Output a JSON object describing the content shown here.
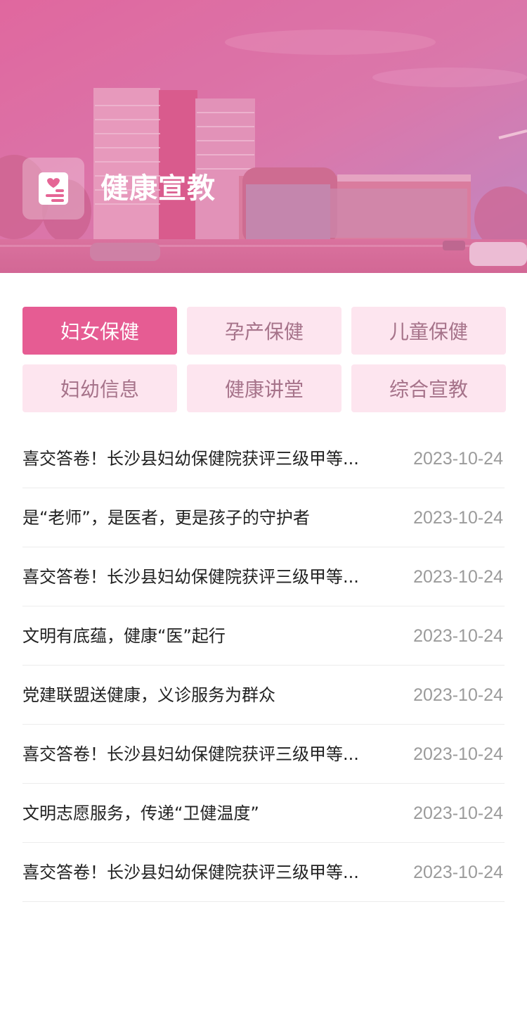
{
  "banner": {
    "title": "健康宣教",
    "icon": "health-record-icon",
    "overlay_color": "#e0619a"
  },
  "tabs": [
    {
      "label": "妇女保健",
      "active": true
    },
    {
      "label": "孕产保健",
      "active": false
    },
    {
      "label": "儿童保健",
      "active": false
    },
    {
      "label": "妇幼信息",
      "active": false
    },
    {
      "label": "健康讲堂",
      "active": false
    },
    {
      "label": "综合宣教",
      "active": false
    }
  ],
  "news": [
    {
      "title": "喜交答卷！长沙县妇幼保健院获评三级甲等...",
      "date": "2023-10-24"
    },
    {
      "title": "是“老师”，是医者，更是孩子的守护者",
      "date": "2023-10-24"
    },
    {
      "title": "喜交答卷！长沙县妇幼保健院获评三级甲等...",
      "date": "2023-10-24"
    },
    {
      "title": "文明有底蕴，健康“医”起行",
      "date": "2023-10-24"
    },
    {
      "title": "党建联盟送健康，义诊服务为群众",
      "date": "2023-10-24"
    },
    {
      "title": "喜交答卷！长沙县妇幼保健院获评三级甲等...",
      "date": "2023-10-24"
    },
    {
      "title": "文明志愿服务，传递“卫健温度”",
      "date": "2023-10-24"
    },
    {
      "title": "喜交答卷！长沙县妇幼保健院获评三级甲等...",
      "date": "2023-10-24"
    }
  ],
  "colors": {
    "tab_active_bg": "#e65c93",
    "tab_inactive_bg": "#fde5ef",
    "tab_inactive_text": "#a6738a",
    "date_text": "#9b9b9b"
  }
}
